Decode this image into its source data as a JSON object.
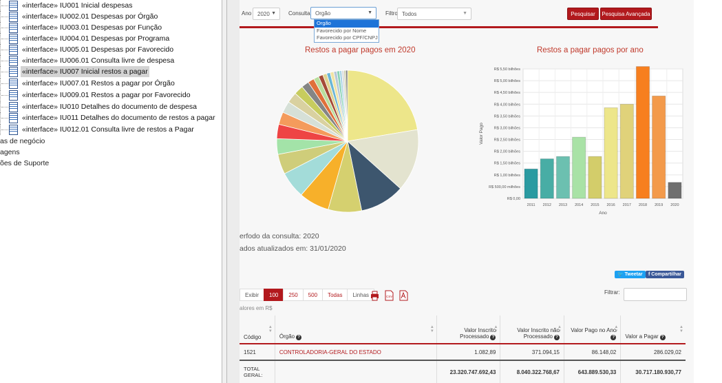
{
  "tree": {
    "items": [
      {
        "label": "«interface» IU001 Inicial despesas",
        "top": 0
      },
      {
        "label": "«interface» IU002.01 Despesas por Órgão",
        "top": 16
      },
      {
        "label": "«interface» IU003.01 Despesas por Função",
        "top": 32
      },
      {
        "label": "«interface» IU004.01 Despesas por Programa",
        "top": 48
      },
      {
        "label": "«interface» IU005.01 Despesas por Favorecido",
        "top": 64
      },
      {
        "label": "«interface» IU006.01 Consulta livre de despesa",
        "top": 80
      },
      {
        "label": "«interface» IU007 Inicial restos a pagar",
        "top": 96,
        "selected": true
      },
      {
        "label": "«interface» IU007.01 Restos a pagar por Órgão",
        "top": 113
      },
      {
        "label": "«interface» IU009.01 Restos a pagar por Favorecido",
        "top": 130
      },
      {
        "label": "«interface» IU010 Detalhes do documento de despesa",
        "top": 147
      },
      {
        "label": "«interface» IU011 Detalhes do documento de restos a pagar",
        "top": 163
      },
      {
        "label": "«interface» IU012.01 Consulta livre de restos a Pagar",
        "top": 180
      }
    ],
    "plain": [
      "as de negócio",
      "agens",
      "ões de Suporte"
    ]
  },
  "filters": {
    "ano_label": "Ano",
    "ano_value": "2020",
    "consulta_label": "Consulta",
    "consulta_value": "Orgão",
    "filtro_label": "Filtro",
    "filtro_value": "Todos",
    "pesquisar": "Pesquisar",
    "pesquisa_avancada": "Pesquisa Avançada",
    "dropdown_options": [
      "Orgão",
      "Favorecido por Nome",
      "Favorecido por CPF/CNPJ"
    ]
  },
  "pie_title": "Restos a pagar pagos em 2020",
  "bar_title": "Restos a pagar pagos por ano",
  "info": {
    "periodo": "erfodo da consulta: 2020",
    "atualizados": "ados atualizados em: 31/01/2020"
  },
  "social": {
    "tweet": "Tweetar",
    "share": "Compartilhar"
  },
  "table_controls": {
    "exibir": "Exibir",
    "sizes": [
      "100",
      "250",
      "500",
      "Todas",
      "Linhas"
    ],
    "valores": "alores em R$",
    "filtrar": "Filtrar:"
  },
  "table": {
    "headers": [
      "Código",
      "Órgão",
      "Valor Inscrito Processado",
      "Valor Inscrito não Processado",
      "Valor Pago no Ano",
      "Valor a Pagar"
    ],
    "rows": [
      [
        "1521",
        "CONTROLADORIA-GERAL DO ESTADO",
        "1.082,89",
        "371.094,15",
        "86.148,02",
        "286.029,02"
      ]
    ],
    "total_label": "TOTAL GERAL:",
    "totals": [
      "23.320.747.692,43",
      "8.040.322.768,67",
      "643.889.530,33",
      "30.717.180.930,77"
    ]
  },
  "chart_data": [
    {
      "type": "pie",
      "title": "Restos a pagar pagos em 2020",
      "values": [
        22,
        14,
        10,
        7.5,
        6.8,
        6,
        4.5,
        3.5,
        3.2,
        2.8,
        2.6,
        2.4,
        2.1,
        1.7,
        1.4,
        1.2,
        1,
        0.9,
        0.8,
        0.8,
        0.7,
        0.6,
        0.5,
        0.5,
        0.4,
        0.4
      ],
      "colors": [
        "#ede68a",
        "#e3e3cf",
        "#3d566e",
        "#d5d06f",
        "#f7b02a",
        "#a3dcd9",
        "#cfcd7a",
        "#a3e3a8",
        "#ee4444",
        "#f49b5c",
        "#d6e0d7",
        "#d9d1a0",
        "#c7cc5e",
        "#858585",
        "#e0703a",
        "#b9de9d",
        "#a54b37",
        "#e0d38f",
        "#6ab6d6",
        "#f1e3a4",
        "#b8c8d8",
        "#89d2b4",
        "#a7d3e5",
        "#ddd",
        "#c9c9a0",
        "#777"
      ]
    },
    {
      "type": "bar",
      "title": "Restos a pagar pagos por ano",
      "xlabel": "Ano",
      "ylabel": "Valor Pago",
      "categories": [
        "2011",
        "2012",
        "2013",
        "2014",
        "2015",
        "2016",
        "2017",
        "2018",
        "2019",
        "2020"
      ],
      "values": [
        1.25,
        1.68,
        1.78,
        2.6,
        1.78,
        3.85,
        4.0,
        5.6,
        4.35,
        0.68
      ],
      "colors": [
        "#2a9aa1",
        "#48ada5",
        "#6cc0b0",
        "#a9e2a6",
        "#d3cd6a",
        "#ede68a",
        "#e0d27a",
        "#f77f1f",
        "#f39a4b",
        "#6f6f6f"
      ],
      "ylim": [
        0,
        5.5
      ],
      "yticks": [
        "R$ 0,00",
        "R$ 500,00 milhões",
        "R$ 1,00 bilhões",
        "R$ 1,50 bilhões",
        "R$ 2,00 bilhões",
        "R$ 2,50 bilhões",
        "R$ 3,00 bilhões",
        "R$ 3,50 bilhões",
        "R$ 4,00 bilhões",
        "R$ 4,50 bilhões",
        "R$ 5,00 bilhões",
        "R$ 5,50 bilhões"
      ],
      "grid": true
    }
  ]
}
